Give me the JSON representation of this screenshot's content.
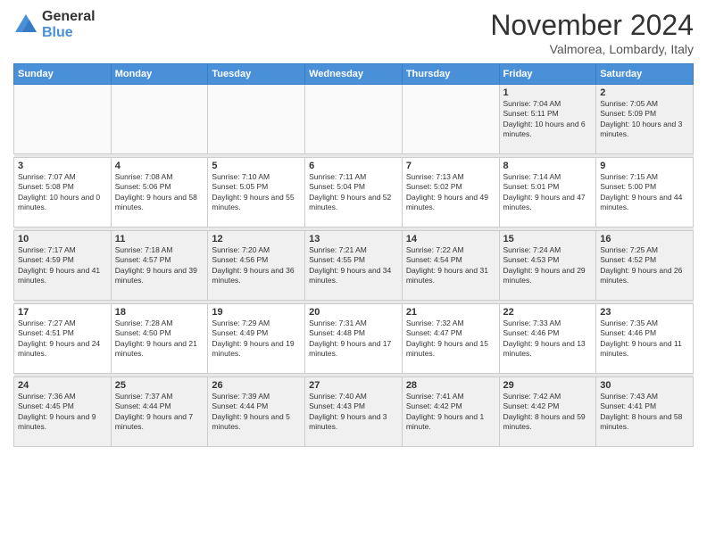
{
  "logo": {
    "general": "General",
    "blue": "Blue"
  },
  "title": "November 2024",
  "location": "Valmorea, Lombardy, Italy",
  "days_of_week": [
    "Sunday",
    "Monday",
    "Tuesday",
    "Wednesday",
    "Thursday",
    "Friday",
    "Saturday"
  ],
  "weeks": [
    [
      {
        "day": "",
        "empty": true
      },
      {
        "day": "",
        "empty": true
      },
      {
        "day": "",
        "empty": true
      },
      {
        "day": "",
        "empty": true
      },
      {
        "day": "",
        "empty": true
      },
      {
        "day": "1",
        "sunrise": "7:04 AM",
        "sunset": "5:11 PM",
        "daylight": "10 hours and 6 minutes."
      },
      {
        "day": "2",
        "sunrise": "7:05 AM",
        "sunset": "5:09 PM",
        "daylight": "10 hours and 3 minutes."
      }
    ],
    [
      {
        "day": "3",
        "sunrise": "7:07 AM",
        "sunset": "5:08 PM",
        "daylight": "10 hours and 0 minutes."
      },
      {
        "day": "4",
        "sunrise": "7:08 AM",
        "sunset": "5:06 PM",
        "daylight": "9 hours and 58 minutes."
      },
      {
        "day": "5",
        "sunrise": "7:10 AM",
        "sunset": "5:05 PM",
        "daylight": "9 hours and 55 minutes."
      },
      {
        "day": "6",
        "sunrise": "7:11 AM",
        "sunset": "5:04 PM",
        "daylight": "9 hours and 52 minutes."
      },
      {
        "day": "7",
        "sunrise": "7:13 AM",
        "sunset": "5:02 PM",
        "daylight": "9 hours and 49 minutes."
      },
      {
        "day": "8",
        "sunrise": "7:14 AM",
        "sunset": "5:01 PM",
        "daylight": "9 hours and 47 minutes."
      },
      {
        "day": "9",
        "sunrise": "7:15 AM",
        "sunset": "5:00 PM",
        "daylight": "9 hours and 44 minutes."
      }
    ],
    [
      {
        "day": "10",
        "sunrise": "7:17 AM",
        "sunset": "4:59 PM",
        "daylight": "9 hours and 41 minutes."
      },
      {
        "day": "11",
        "sunrise": "7:18 AM",
        "sunset": "4:57 PM",
        "daylight": "9 hours and 39 minutes."
      },
      {
        "day": "12",
        "sunrise": "7:20 AM",
        "sunset": "4:56 PM",
        "daylight": "9 hours and 36 minutes."
      },
      {
        "day": "13",
        "sunrise": "7:21 AM",
        "sunset": "4:55 PM",
        "daylight": "9 hours and 34 minutes."
      },
      {
        "day": "14",
        "sunrise": "7:22 AM",
        "sunset": "4:54 PM",
        "daylight": "9 hours and 31 minutes."
      },
      {
        "day": "15",
        "sunrise": "7:24 AM",
        "sunset": "4:53 PM",
        "daylight": "9 hours and 29 minutes."
      },
      {
        "day": "16",
        "sunrise": "7:25 AM",
        "sunset": "4:52 PM",
        "daylight": "9 hours and 26 minutes."
      }
    ],
    [
      {
        "day": "17",
        "sunrise": "7:27 AM",
        "sunset": "4:51 PM",
        "daylight": "9 hours and 24 minutes."
      },
      {
        "day": "18",
        "sunrise": "7:28 AM",
        "sunset": "4:50 PM",
        "daylight": "9 hours and 21 minutes."
      },
      {
        "day": "19",
        "sunrise": "7:29 AM",
        "sunset": "4:49 PM",
        "daylight": "9 hours and 19 minutes."
      },
      {
        "day": "20",
        "sunrise": "7:31 AM",
        "sunset": "4:48 PM",
        "daylight": "9 hours and 17 minutes."
      },
      {
        "day": "21",
        "sunrise": "7:32 AM",
        "sunset": "4:47 PM",
        "daylight": "9 hours and 15 minutes."
      },
      {
        "day": "22",
        "sunrise": "7:33 AM",
        "sunset": "4:46 PM",
        "daylight": "9 hours and 13 minutes."
      },
      {
        "day": "23",
        "sunrise": "7:35 AM",
        "sunset": "4:46 PM",
        "daylight": "9 hours and 11 minutes."
      }
    ],
    [
      {
        "day": "24",
        "sunrise": "7:36 AM",
        "sunset": "4:45 PM",
        "daylight": "9 hours and 9 minutes."
      },
      {
        "day": "25",
        "sunrise": "7:37 AM",
        "sunset": "4:44 PM",
        "daylight": "9 hours and 7 minutes."
      },
      {
        "day": "26",
        "sunrise": "7:39 AM",
        "sunset": "4:44 PM",
        "daylight": "9 hours and 5 minutes."
      },
      {
        "day": "27",
        "sunrise": "7:40 AM",
        "sunset": "4:43 PM",
        "daylight": "9 hours and 3 minutes."
      },
      {
        "day": "28",
        "sunrise": "7:41 AM",
        "sunset": "4:42 PM",
        "daylight": "9 hours and 1 minute."
      },
      {
        "day": "29",
        "sunrise": "7:42 AM",
        "sunset": "4:42 PM",
        "daylight": "8 hours and 59 minutes."
      },
      {
        "day": "30",
        "sunrise": "7:43 AM",
        "sunset": "4:41 PM",
        "daylight": "8 hours and 58 minutes."
      }
    ]
  ]
}
